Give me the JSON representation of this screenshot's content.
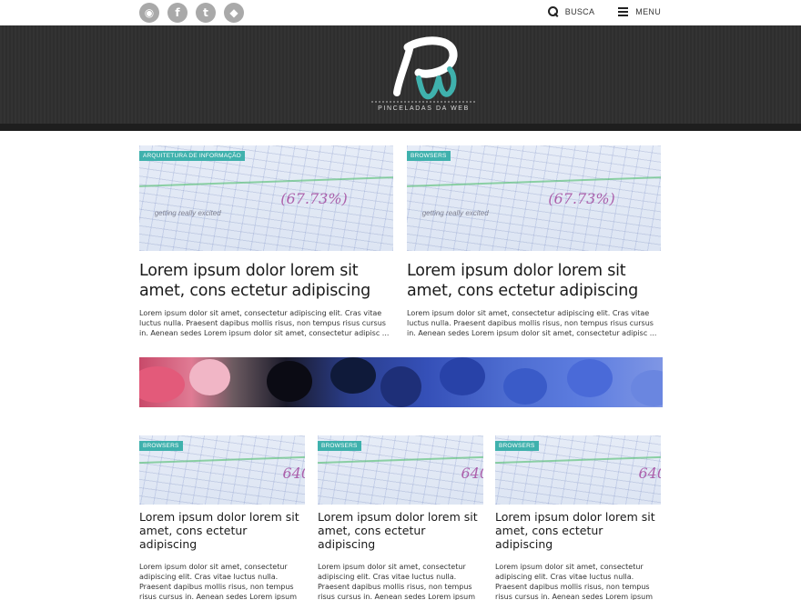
{
  "topbar": {
    "social": [
      {
        "name": "rss-icon",
        "glyph": "◉"
      },
      {
        "name": "facebook-icon",
        "glyph": "f"
      },
      {
        "name": "twitter-icon",
        "glyph": "t"
      },
      {
        "name": "github-icon",
        "glyph": "◆"
      }
    ],
    "search_label": "BUSCA",
    "menu_label": "MENU"
  },
  "header": {
    "logo_letters": "Pw",
    "tagline": "PINCELADAS DA WEB"
  },
  "featured": [
    {
      "category": "ARQUITETURA DE INFORMAÇÃO",
      "title": "Lorem ipsum dolor lorem sit amet, cons ectetur adipiscing",
      "excerpt": "Lorem ipsum dolor sit amet, consectetur adipiscing elit. Cras vitae luctus nulla. Praesent dapibus mollis risus, non tempus risus cursus in. Aenean sedes Lorem ipsum dolor sit amet, consectetur adipisc ..."
    },
    {
      "category": "BROWSERS",
      "title": "Lorem ipsum dolor lorem sit amet, cons ectetur adipiscing",
      "excerpt": "Lorem ipsum dolor sit amet, consectetur adipiscing elit. Cras vitae luctus nulla. Praesent dapibus mollis risus, non tempus risus cursus in. Aenean sedes Lorem ipsum dolor sit amet, consectetur adipisc ..."
    }
  ],
  "posts": [
    {
      "category": "BROWSERS",
      "title": "Lorem ipsum dolor lorem sit amet, cons ectetur adipiscing",
      "excerpt": "Lorem ipsum dolor sit amet, consectetur adipiscing elit. Cras vitae luctus nulla. Praesent dapibus mollis risus, non tempus risus cursus in. Aenean sedes Lorem ipsum dolor sit amet, consectetur adipisc ..."
    },
    {
      "category": "BROWSERS",
      "title": "Lorem ipsum dolor lorem sit amet, cons ectetur adipiscing",
      "excerpt": "Lorem ipsum dolor sit amet, consectetur adipiscing elit. Cras vitae luctus nulla. Praesent dapibus mollis risus, non tempus risus cursus in. Aenean sedes Lorem ipsum dolor sit amet, consectetur adipisc ..."
    },
    {
      "category": "BROWSERS",
      "title": "Lorem ipsum dolor lorem sit amet, cons ectetur adipiscing",
      "excerpt": "Lorem ipsum dolor sit amet, consectetur adipiscing elit. Cras vitae luctus nulla. Praesent dapibus mollis risus, non tempus risus cursus in. Aenean sedes Lorem ipsum dolor sit amet, consectetur adipisc ..."
    }
  ],
  "colors": {
    "accent": "#3fb1ad",
    "header_bg": "#333333",
    "social_icon_bg": "#a9a9a9"
  }
}
